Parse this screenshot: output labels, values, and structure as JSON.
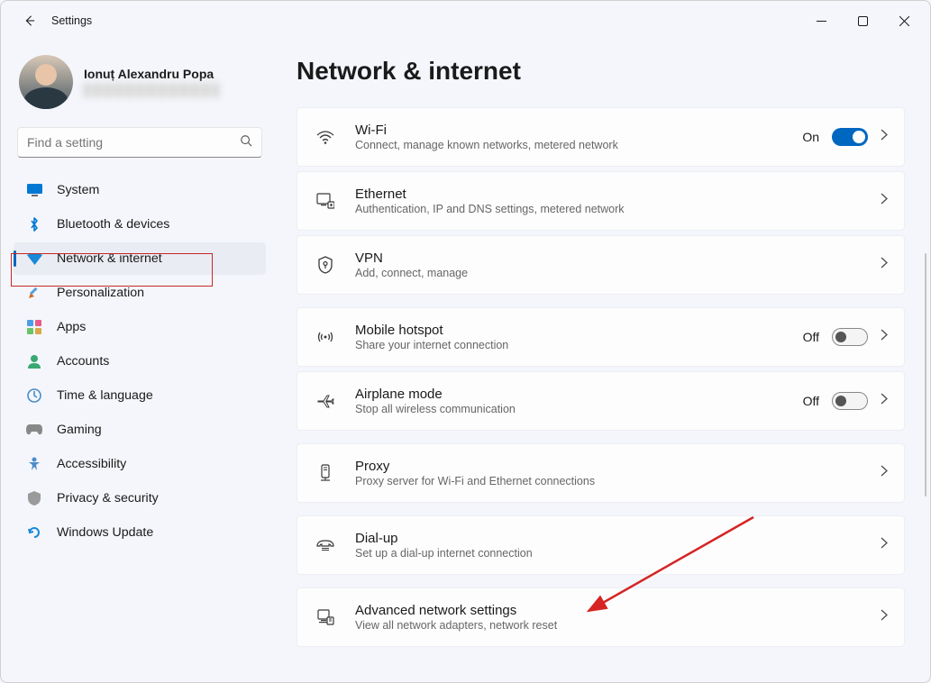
{
  "window": {
    "title": "Settings"
  },
  "profile": {
    "name": "Ionuț Alexandru Popa"
  },
  "search": {
    "placeholder": "Find a setting"
  },
  "sidebar": {
    "items": [
      {
        "label": "System"
      },
      {
        "label": "Bluetooth & devices"
      },
      {
        "label": "Network & internet",
        "selected": true
      },
      {
        "label": "Personalization"
      },
      {
        "label": "Apps"
      },
      {
        "label": "Accounts"
      },
      {
        "label": "Time & language"
      },
      {
        "label": "Gaming"
      },
      {
        "label": "Accessibility"
      },
      {
        "label": "Privacy & security"
      },
      {
        "label": "Windows Update"
      }
    ]
  },
  "page": {
    "title": "Network & internet"
  },
  "settings": {
    "wifi": {
      "title": "Wi-Fi",
      "subtitle": "Connect, manage known networks, metered network",
      "state_label": "On",
      "state": "on"
    },
    "ethernet": {
      "title": "Ethernet",
      "subtitle": "Authentication, IP and DNS settings, metered network"
    },
    "vpn": {
      "title": "VPN",
      "subtitle": "Add, connect, manage"
    },
    "hotspot": {
      "title": "Mobile hotspot",
      "subtitle": "Share your internet connection",
      "state_label": "Off",
      "state": "off"
    },
    "airplane": {
      "title": "Airplane mode",
      "subtitle": "Stop all wireless communication",
      "state_label": "Off",
      "state": "off"
    },
    "proxy": {
      "title": "Proxy",
      "subtitle": "Proxy server for Wi-Fi and Ethernet connections"
    },
    "dialup": {
      "title": "Dial-up",
      "subtitle": "Set up a dial-up internet connection"
    },
    "advanced": {
      "title": "Advanced network settings",
      "subtitle": "View all network adapters, network reset"
    }
  }
}
